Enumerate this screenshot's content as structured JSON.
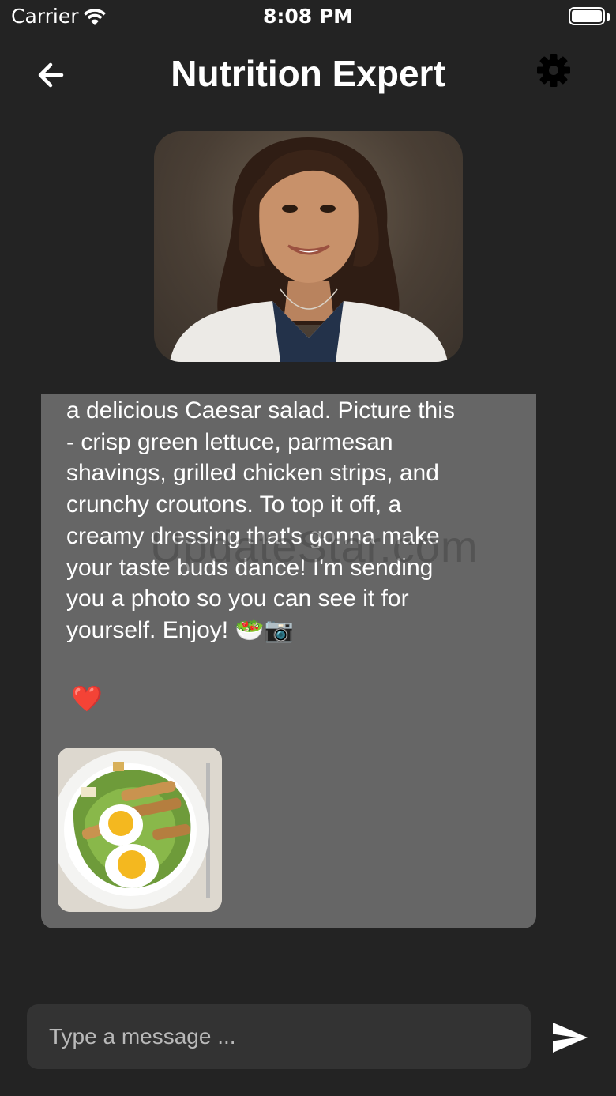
{
  "status_bar": {
    "carrier": "Carrier",
    "time": "8:08 PM",
    "battery_percent": 100
  },
  "header": {
    "title": "Nutrition Expert",
    "back_icon": "arrow-left-icon",
    "settings_icon": "gear-icon"
  },
  "chat": {
    "avatar_icon": "nutritionist-portrait",
    "message": {
      "text": "a delicious Caesar salad. Picture this\n- crisp green lettuce, parmesan\nshavings, grilled chicken strips, and\ncrunchy croutons. To top it off, a\ncreamy dressing that's gonna make\nyour taste buds dance! I'm sending\nyou a photo so you can see it for\nyourself. Enjoy! 🥗📷",
      "reaction": "❤️",
      "attachment_icon": "caesar-salad-photo"
    },
    "watermark": "UpdateStar.com"
  },
  "composer": {
    "placeholder": "Type a message ...",
    "value": "",
    "send_icon": "send-icon"
  },
  "colors": {
    "background": "#232323",
    "bubble": "#666666",
    "input": "#333333",
    "text": "#ffffff"
  }
}
